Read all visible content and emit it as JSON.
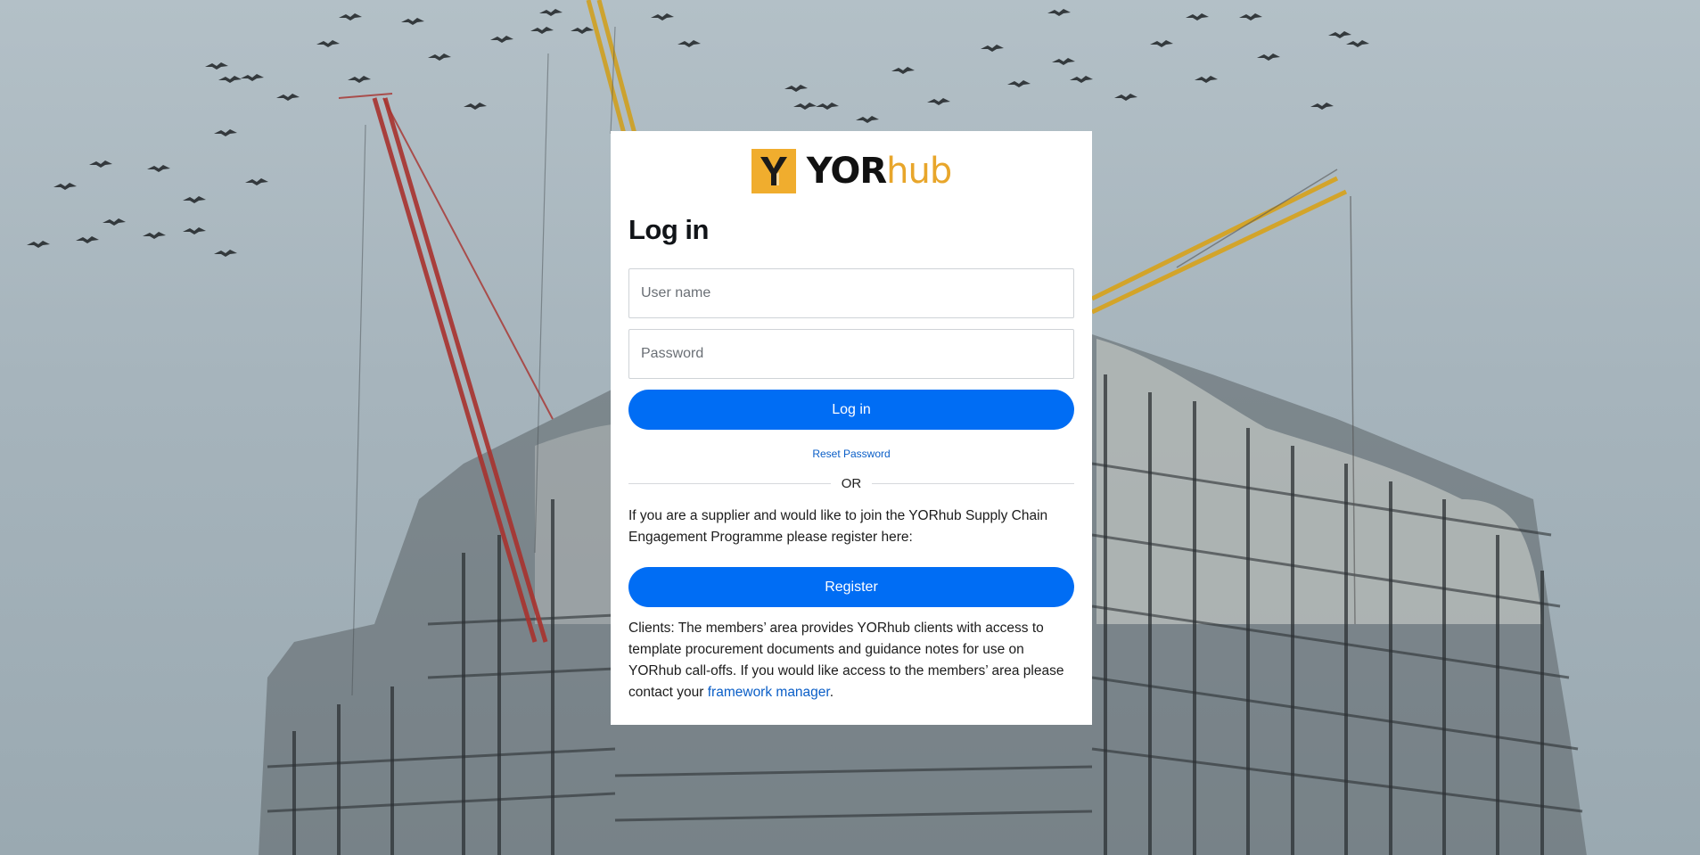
{
  "brand": {
    "mark_letter": "Y",
    "name_strong": "YOR",
    "name_light": "hub",
    "colors": {
      "mark_bg": "#f0ad2e",
      "accent_text": "#e8a62b",
      "primary_button": "#006df4",
      "link": "#0a5ec7"
    }
  },
  "background": {
    "description_icon": "construction-site-scene"
  },
  "login": {
    "title": "Log in",
    "username_placeholder": "User name",
    "username_value": "",
    "password_placeholder": "Password",
    "password_value": "",
    "login_button": "Log in",
    "reset_link": "Reset Password",
    "divider_text": "OR"
  },
  "supplier": {
    "text": "If you are a supplier and would like to join the YORhub Supply Chain Engagement Programme please register here:",
    "register_button": "Register"
  },
  "clients": {
    "text_before_link": "Clients: The members’ area provides YORhub clients with access to template procurement documents and guidance notes for use on YORhub call-offs. If you would like access to the members’ area please contact your ",
    "link_text": "framework manager",
    "text_after_link": "."
  }
}
